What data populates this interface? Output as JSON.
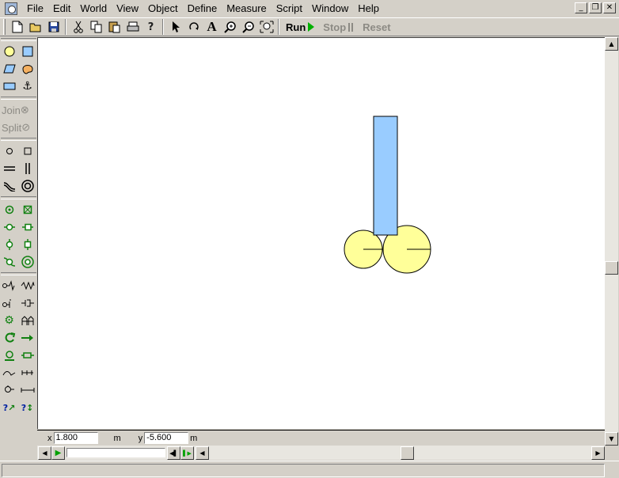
{
  "menubar": {
    "items": [
      "File",
      "Edit",
      "World",
      "View",
      "Object",
      "Define",
      "Measure",
      "Script",
      "Window",
      "Help"
    ]
  },
  "window_buttons": {
    "minimize": "_",
    "restore": "❐",
    "close": "✕"
  },
  "toolbar": {
    "run_label": "Run",
    "stop_label": "Stop",
    "reset_label": "Reset"
  },
  "palette": {
    "join_label": "Join",
    "split_label": "Split"
  },
  "coords": {
    "x_label": "x",
    "x_value": "1.800",
    "x_unit": "m",
    "y_label": "y",
    "y_value": "-5.600",
    "y_unit": "m"
  },
  "colors": {
    "rect_fill": "#99ccff",
    "circle_fill": "#ffff99",
    "run_green": "#00b000"
  }
}
